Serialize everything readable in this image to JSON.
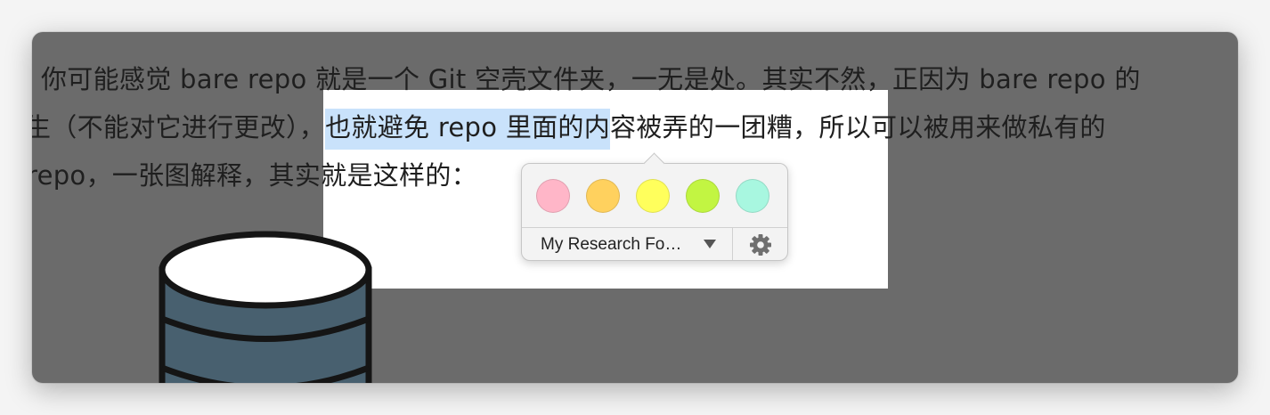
{
  "article": {
    "line1": "你可能感觉 bare repo 就是一个 Git 空壳文件夹，一无是处。其实不然，正因为 bare repo 的",
    "line2_before": "生（不能对它进行更改），",
    "line2_highlight": "也就避免 repo 里面的内",
    "line2_after": "容被弄的一团糟，所以可以被用来做私有的",
    "line3": "repo，一张图解释，其实就是这样的："
  },
  "highlight_popup": {
    "colors": [
      {
        "name": "pink",
        "hex": "#ffb6c8"
      },
      {
        "name": "orange",
        "hex": "#ffd15e"
      },
      {
        "name": "yellow",
        "hex": "#ffff5c"
      },
      {
        "name": "green",
        "hex": "#c2f542"
      },
      {
        "name": "mint",
        "hex": "#a8f7e0"
      }
    ],
    "folder_label": "My Research Fo…",
    "dropdown_icon": "triangle-down-icon",
    "settings_icon": "gear-icon"
  },
  "colors": {
    "overlay": "#6b6b6b",
    "highlight": "#c9e2fb",
    "database_fill": "#48606f"
  }
}
